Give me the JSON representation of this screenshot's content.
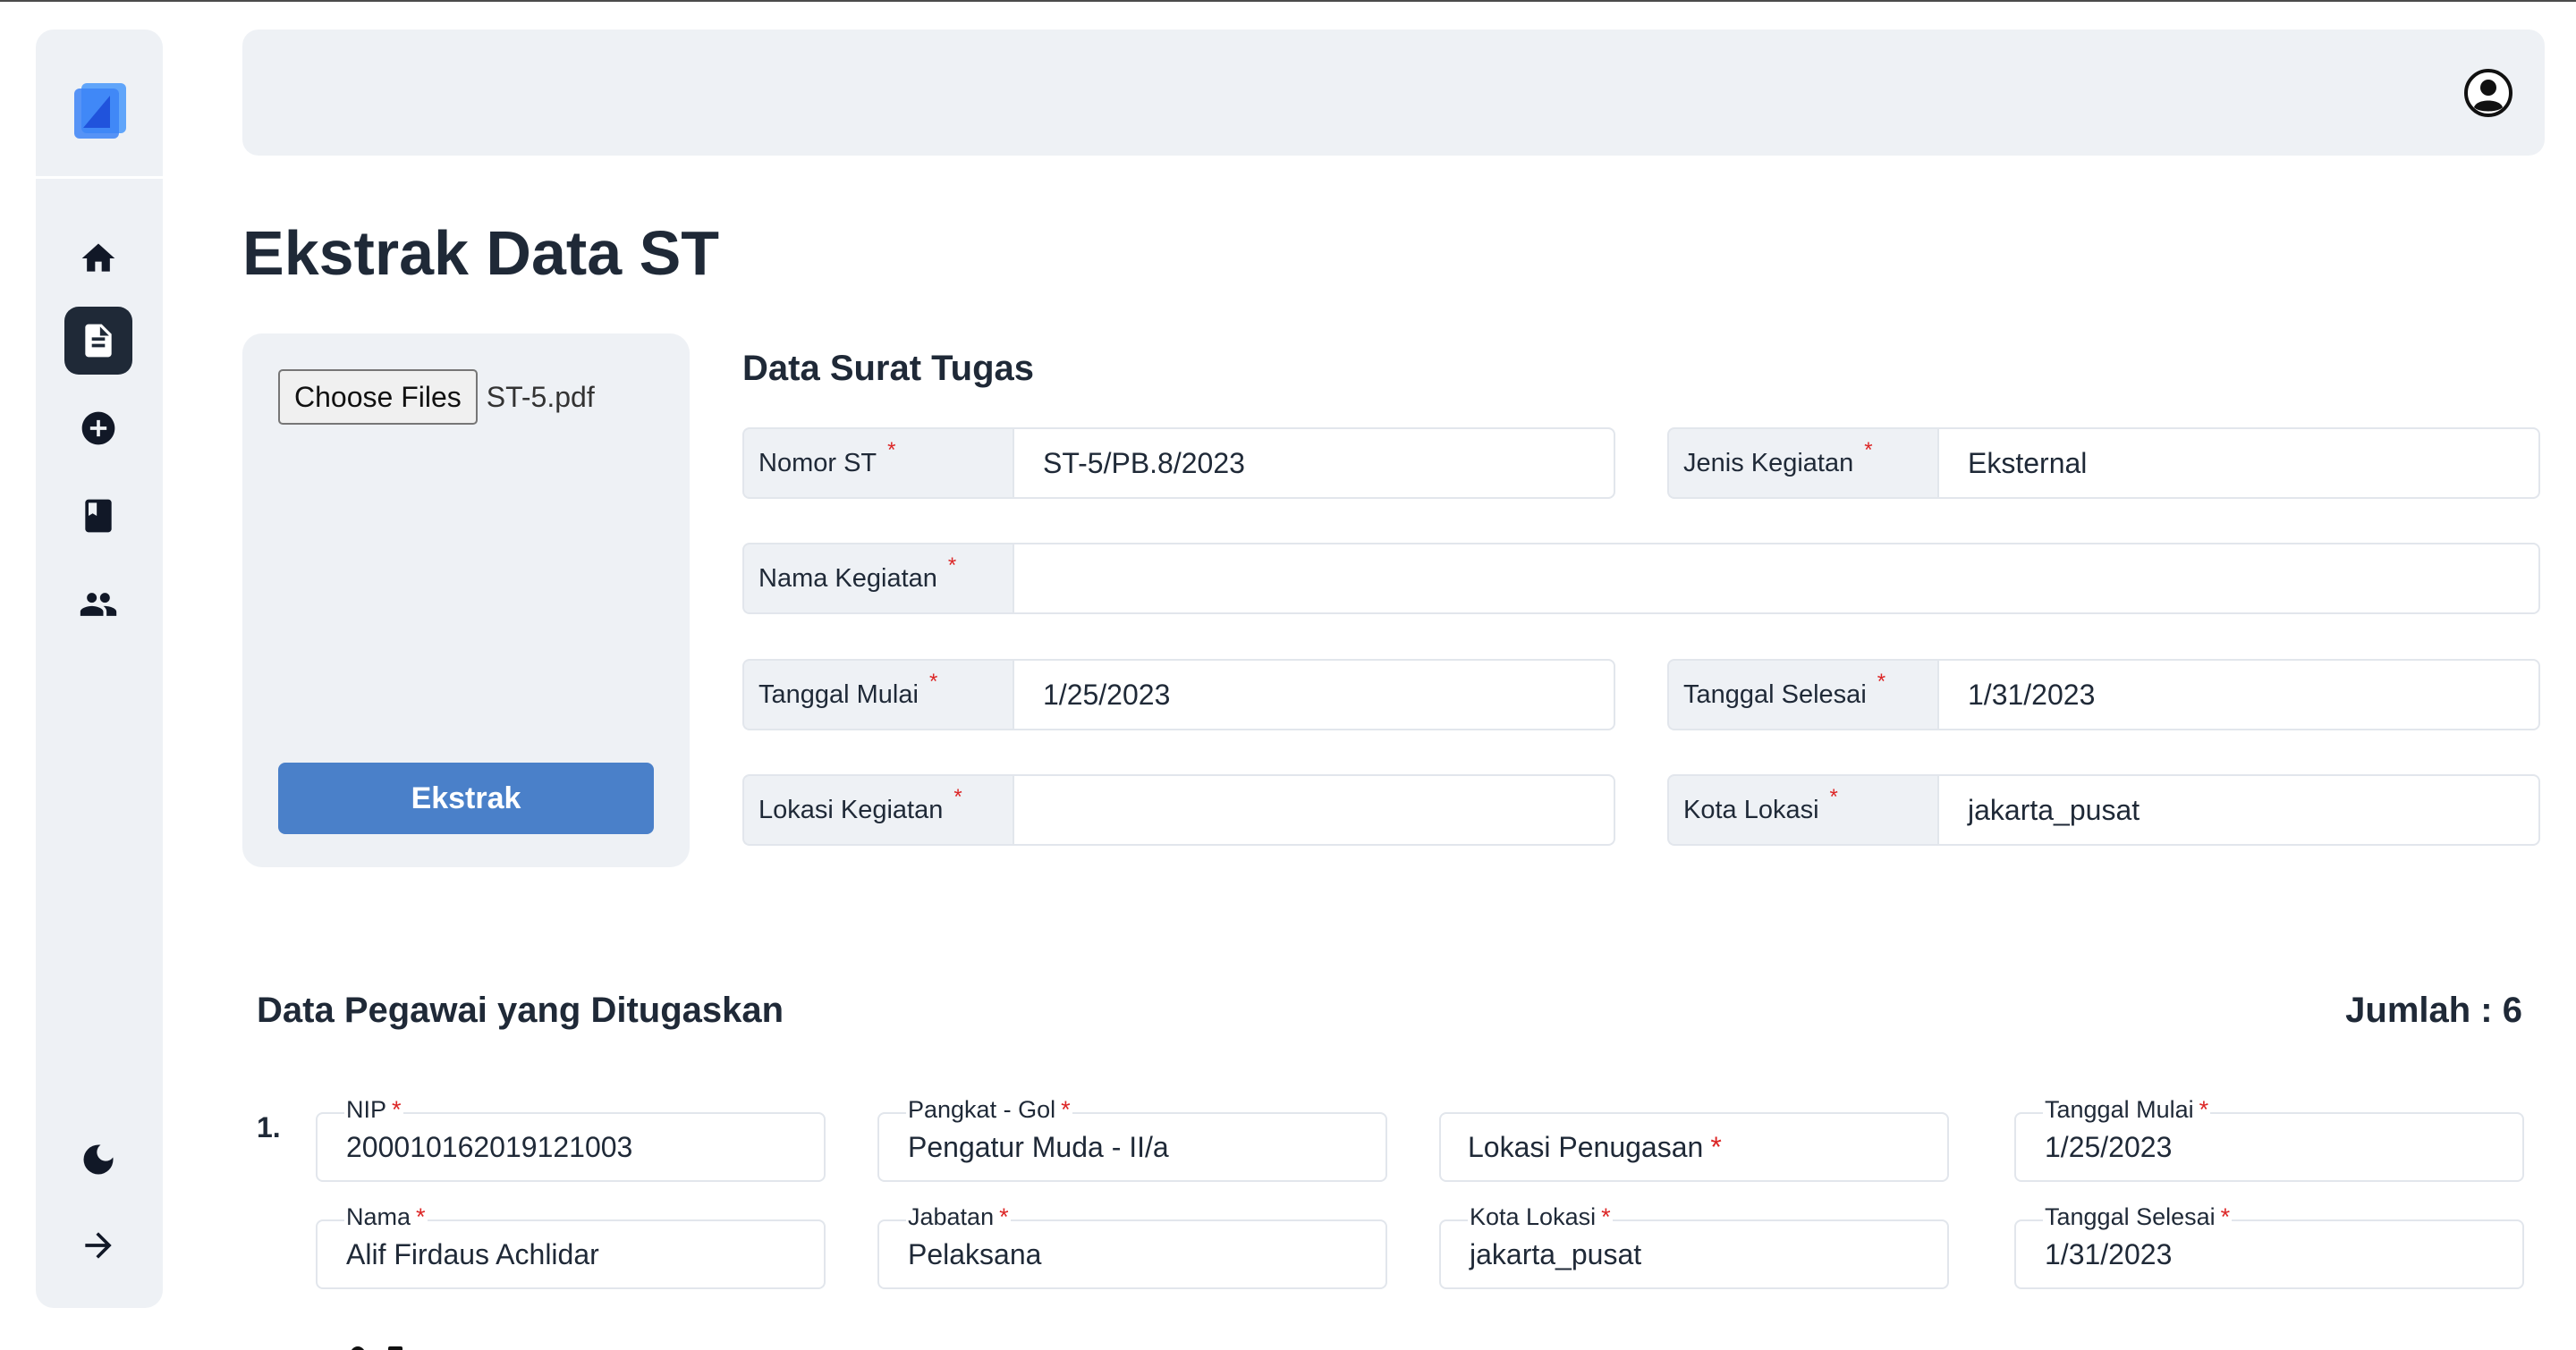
{
  "page": {
    "title": "Ekstrak Data ST"
  },
  "sidebar": {
    "items": [
      {
        "icon": "home-icon"
      },
      {
        "icon": "document-icon",
        "active": true
      },
      {
        "icon": "add-circle-icon"
      },
      {
        "icon": "book-icon"
      },
      {
        "icon": "people-icon"
      }
    ],
    "bottom": [
      {
        "icon": "moon-icon"
      },
      {
        "icon": "arrow-right-icon"
      }
    ]
  },
  "upload": {
    "choose_label": "Choose Files",
    "file_name": "ST-5.pdf",
    "button_label": "Ekstrak"
  },
  "surat_tugas": {
    "title": "Data Surat Tugas",
    "nomor_st": {
      "label": "Nomor ST",
      "value": "ST-5/PB.8/2023"
    },
    "jenis_kegiatan": {
      "label": "Jenis Kegiatan",
      "value": "Eksternal"
    },
    "nama_kegiatan": {
      "label": "Nama Kegiatan",
      "value": ""
    },
    "tanggal_mulai": {
      "label": "Tanggal Mulai",
      "value": "1/25/2023"
    },
    "tanggal_selesai": {
      "label": "Tanggal Selesai",
      "value": "1/31/2023"
    },
    "lokasi_kegiatan": {
      "label": "Lokasi Kegiatan",
      "value": ""
    },
    "kota_lokasi": {
      "label": "Kota Lokasi",
      "value": "jakarta_pusat"
    }
  },
  "pegawai": {
    "title": "Data Pegawai yang Ditugaskan",
    "jumlah": "Jumlah : 6",
    "rows": [
      {
        "number": "1.",
        "nip": {
          "label": "NIP",
          "value": "200010162019121003"
        },
        "nama": {
          "label": "Nama",
          "value": "Alif Firdaus Achlidar"
        },
        "pangkat": {
          "label": "Pangkat - Gol",
          "value": "Pengatur Muda - II/a"
        },
        "jabatan": {
          "label": "Jabatan",
          "value": "Pelaksana"
        },
        "lokasi_penugasan": {
          "placeholder": "Lokasi Penugasan"
        },
        "kota_lokasi": {
          "label": "Kota Lokasi",
          "value": "jakarta_pusat"
        },
        "tanggal_mulai": {
          "label": "Tanggal Mulai",
          "value": "1/25/2023"
        },
        "tanggal_selesai": {
          "label": "Tanggal Selesai",
          "value": "1/31/2023"
        }
      }
    ]
  },
  "required_mark": "*",
  "colors": {
    "accent": "#4a80c9",
    "required": "#dc2626",
    "panel": "#eef1f5",
    "active_nav": "#1f2937"
  }
}
